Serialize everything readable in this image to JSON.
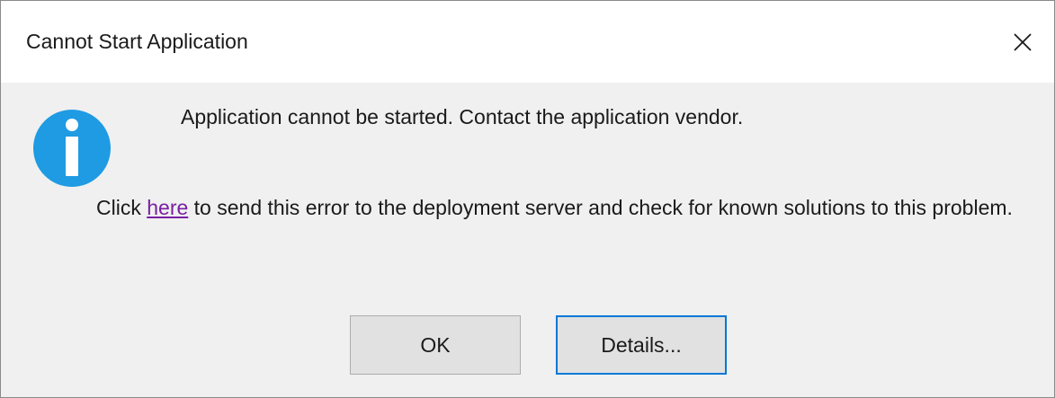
{
  "window": {
    "title": "Cannot Start Application",
    "close_label": "close"
  },
  "icon": {
    "name": "info-icon",
    "color": "#1e9be3"
  },
  "message": {
    "main": "Application cannot be started. Contact the application vendor.",
    "detail_prefix": "Click ",
    "detail_link": "here",
    "detail_suffix": " to send this error to the deployment server and check for known solutions to this problem."
  },
  "buttons": {
    "ok_label": "OK",
    "details_label": "Details..."
  },
  "colors": {
    "link": "#7a1fa2",
    "focus_border": "#0078d7"
  }
}
